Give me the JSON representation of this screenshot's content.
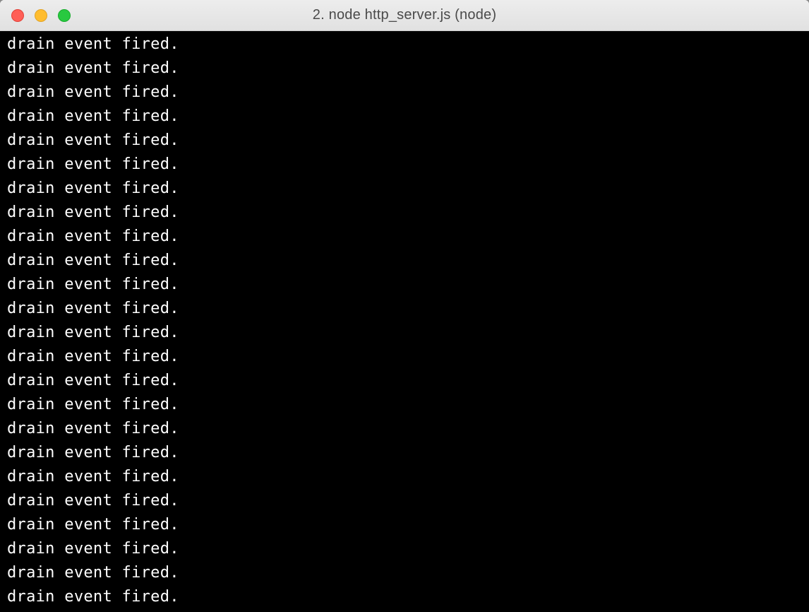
{
  "window": {
    "title": "2. node http_server.js (node)"
  },
  "terminal": {
    "lines": [
      "drain event fired.",
      "drain event fired.",
      "drain event fired.",
      "drain event fired.",
      "drain event fired.",
      "drain event fired.",
      "drain event fired.",
      "drain event fired.",
      "drain event fired.",
      "drain event fired.",
      "drain event fired.",
      "drain event fired.",
      "drain event fired.",
      "drain event fired.",
      "drain event fired.",
      "drain event fired.",
      "drain event fired.",
      "drain event fired.",
      "drain event fired.",
      "drain event fired.",
      "drain event fired.",
      "drain event fired.",
      "drain event fired.",
      "drain event fired."
    ]
  }
}
